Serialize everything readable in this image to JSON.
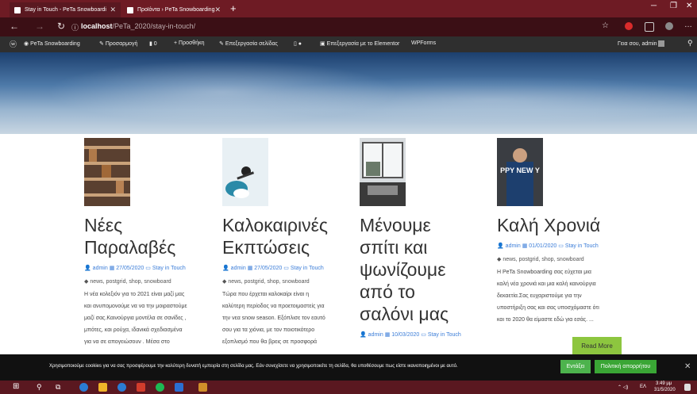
{
  "browser": {
    "tabs": [
      {
        "title": "Stay in Touch - PeTa Snowboardi",
        "active": true
      },
      {
        "title": "Προϊόντα › PeTa Snowboarding",
        "active": false
      }
    ],
    "new_tab": "+",
    "url_host": "localhost",
    "url_path": "/PeTa_2020/stay-in-touch/"
  },
  "adminbar": {
    "site": "PeTa Snowboarding",
    "customize": "Προσαρμογή",
    "comments": "0",
    "add_new": "Προσθήκη",
    "edit_page": "Επεξεργασία σελίδας",
    "elementor": "Επεξεργασία με το Elementor",
    "wpforms": "WPForms",
    "greeting": "Γεια σου, admin"
  },
  "posts": [
    {
      "title_lines": [
        "Νέες",
        "Παραλαβές"
      ],
      "author": "admin",
      "date": "27/05/2020",
      "category": "Stay in Touch",
      "tags": "news, postgrid, shop, snowboard",
      "excerpt_lines": [
        "Η νέα κολεξιόν για το 2021 είναι μαζί μας",
        "και ανυπομονούμε να να την μοιραστούμε",
        "μαζί σας.Καινούργια μοντέλα σε σανίδες ,",
        "μπότες, και ρούχα, ιδανικά σχεδιασμένα",
        "για να σε απογειώσουν . Μέσα στο"
      ]
    },
    {
      "title_lines": [
        "Καλοκαιρινές",
        "Εκπτώσεις"
      ],
      "author": "admin",
      "date": "27/05/2020",
      "category": "Stay in Touch",
      "tags": "news, postgrid, shop, snowboard",
      "excerpt_lines": [
        "Τώρα που έρχεται καλοκαίρι είναι η",
        "καλύτερη περίοδος να προετοιμαστείς για",
        "την νεα snow season. Εξόπλισε τον εαυτό",
        "σου για τα χιόνια, με τον ποιοτικότερο",
        "εξοπλισμό που θα βρεις σε προσφορά"
      ]
    },
    {
      "title_lines": [
        "Μένουμε",
        "σπίτι και",
        "ψωνίζουμε",
        "από το",
        "σαλόνι μας"
      ],
      "author": "admin",
      "date": "10/03/2020",
      "category": "Stay in Touch",
      "tags": "",
      "excerpt_lines": []
    },
    {
      "title_lines": [
        "Καλή Χρονιά"
      ],
      "thumb_text": "PPY NEW Y",
      "author": "admin",
      "date": "01/01/2020",
      "category": "Stay in Touch",
      "tags": "news, postgrid, shop, snowboard",
      "excerpt_lines": [
        "Η PeTa Snowboarding σας εύχεται μια",
        "καλή νέα χρονιά και μια καλή καινούργια",
        "δεκαετία.Σας ευχαριστούμε για την",
        "υποστήριξη σας και σας υποσχόμαστε ότι",
        "και το 2020 θα είμαστε εδώ για εσάς. ..."
      ]
    }
  ],
  "read_more": "Read More",
  "cookie": {
    "text": "Χρησιμοποιούμε cookies για να σας προσφέρουμε την καλύτερη δυνατή εμπειρία στη σελίδα μας. Εάν συνεχίσετε να χρησιμοποιείτε τη σελίδα, θα υποθέσουμε πως είστε ικανοποιημένοι με αυτό.",
    "accept": "Εντάξει",
    "policy": "Πολιτική απορρήτου",
    "close": "✕"
  },
  "taskbar": {
    "lang": "ΕΛ",
    "time": "3:49 μμ",
    "date": "31/5/2020"
  },
  "colors": {
    "tabbar": "#6e1b24",
    "addrbar": "#3b0f15",
    "link": "#3b7dd8",
    "accept_button": "#4db34d",
    "policy_button": "#3aa635",
    "read_more": "#8dc63f"
  }
}
